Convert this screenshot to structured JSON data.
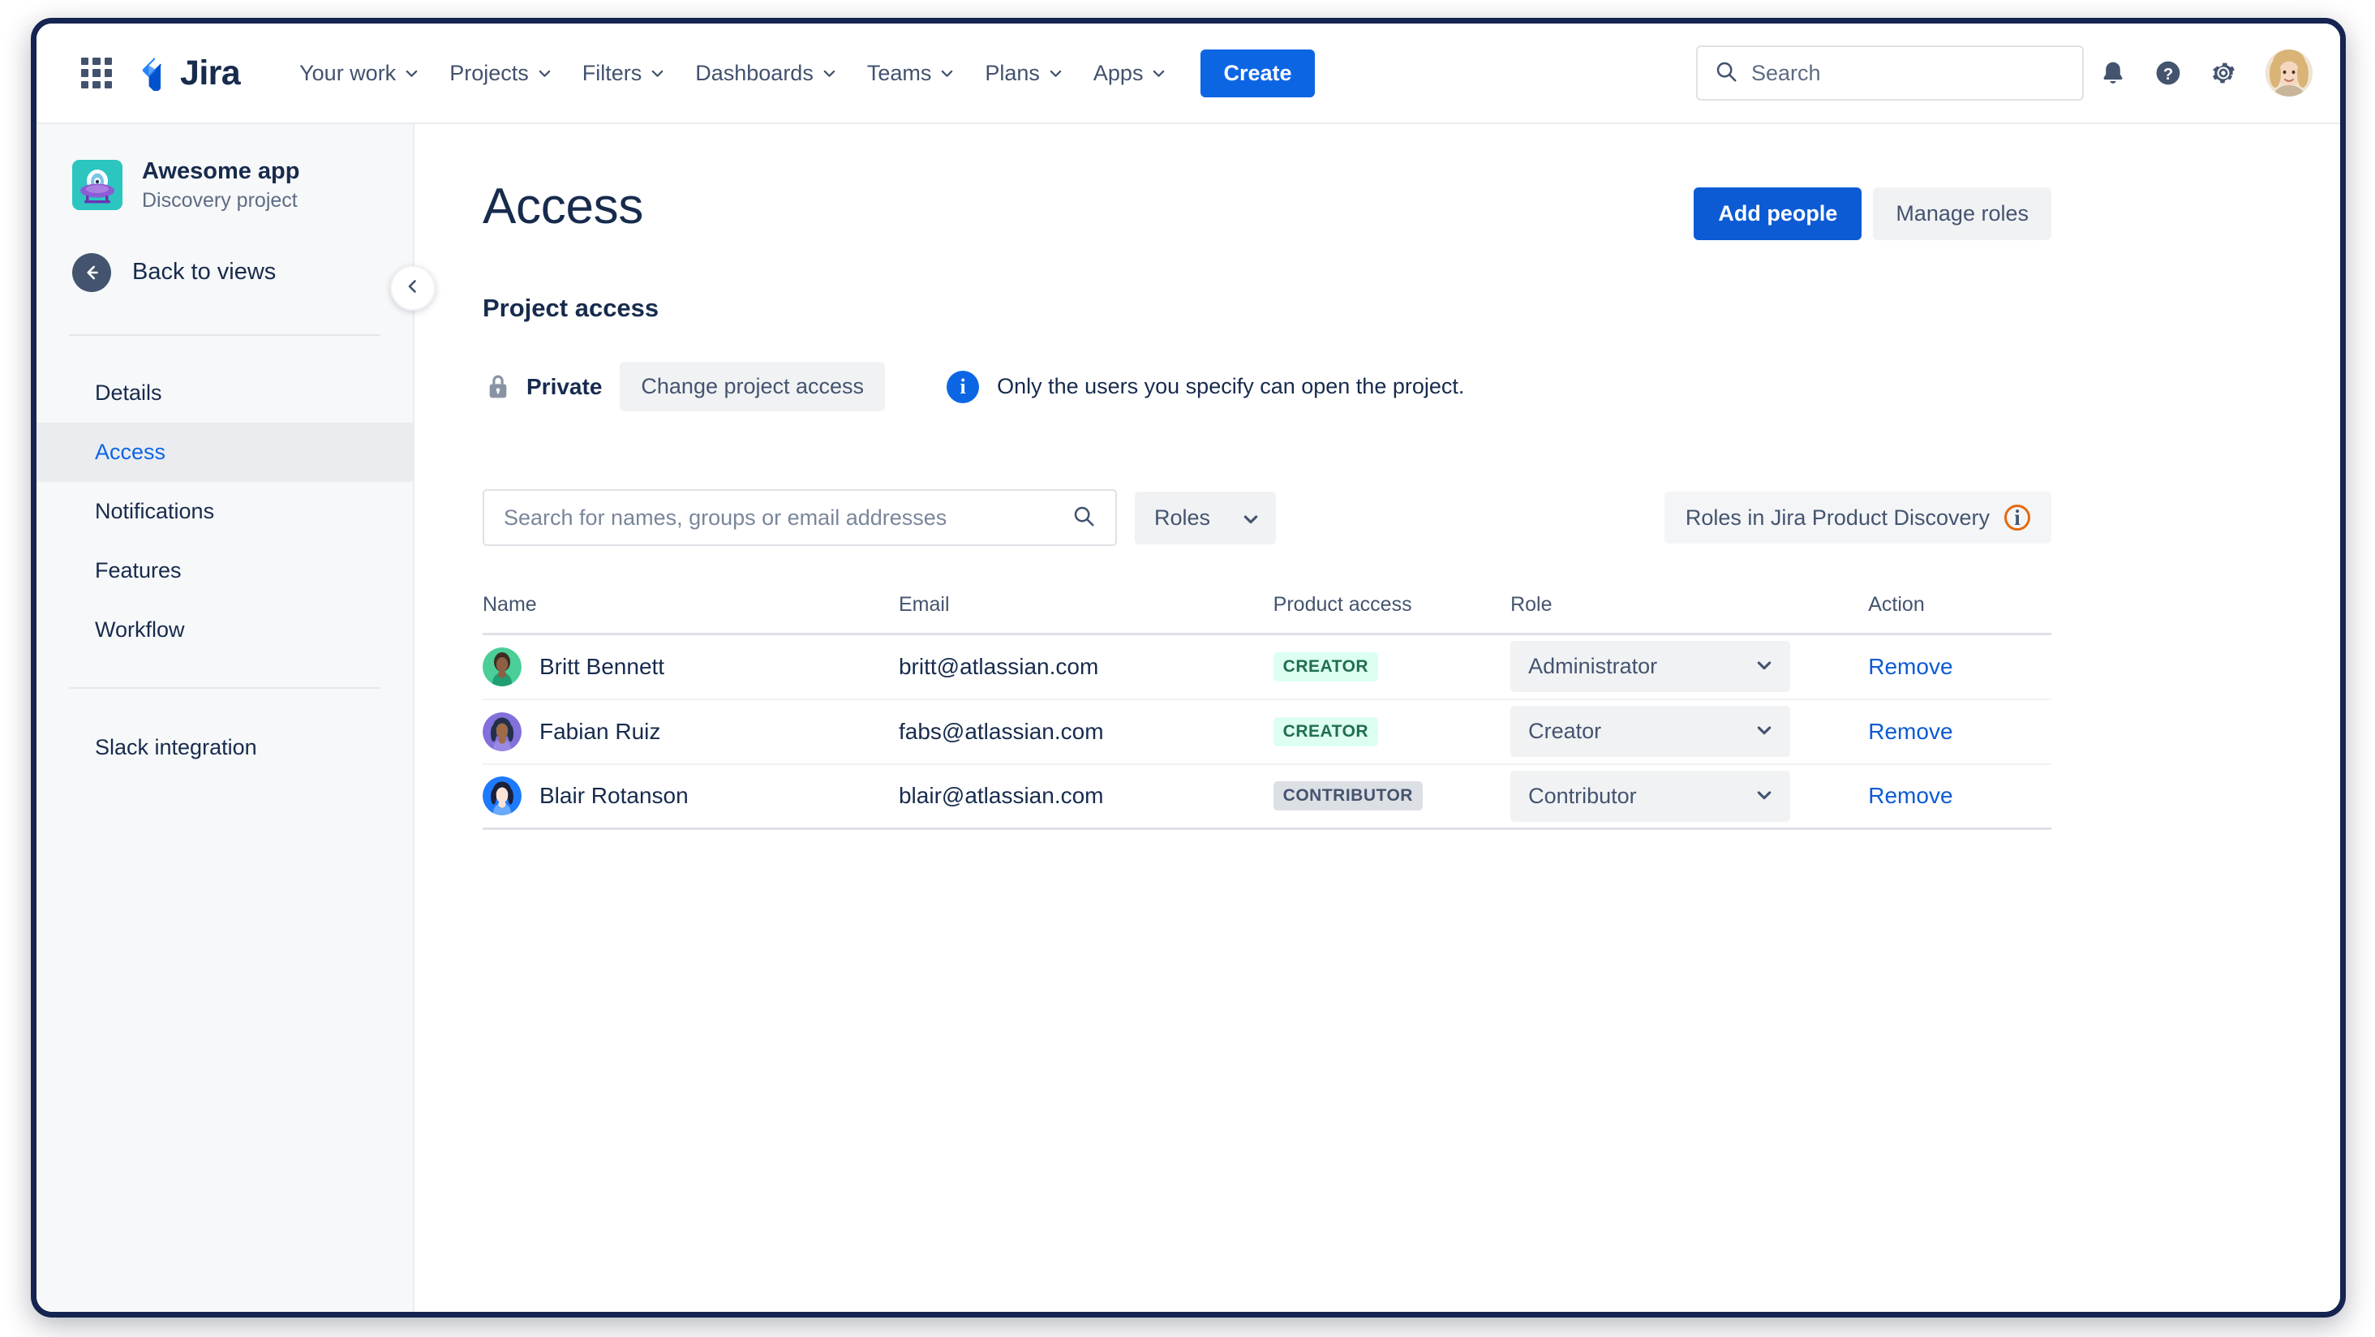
{
  "topnav": {
    "app_switcher": "app-switcher",
    "logo_text": "Jira",
    "items": [
      {
        "label": "Your work"
      },
      {
        "label": "Projects"
      },
      {
        "label": "Filters"
      },
      {
        "label": "Dashboards"
      },
      {
        "label": "Teams"
      },
      {
        "label": "Plans"
      },
      {
        "label": "Apps"
      }
    ],
    "create_label": "Create",
    "search_placeholder": "Search",
    "search_value": "",
    "icons": [
      "notifications-icon",
      "help-icon",
      "settings-icon",
      "profile-avatar"
    ]
  },
  "sidebar": {
    "project_name": "Awesome app",
    "project_type": "Discovery project",
    "back_label": "Back to views",
    "collapse_label": "collapse-sidebar",
    "items": [
      {
        "label": "Details",
        "active": false
      },
      {
        "label": "Access",
        "active": true
      },
      {
        "label": "Notifications",
        "active": false
      },
      {
        "label": "Features",
        "active": false
      },
      {
        "label": "Workflow",
        "active": false
      }
    ],
    "secondary_items": [
      {
        "label": "Slack integration"
      }
    ]
  },
  "main": {
    "page_title": "Access",
    "add_people_label": "Add people",
    "manage_roles_label": "Manage roles",
    "section_title": "Project access",
    "private_label": "Private",
    "change_access_label": "Change project access",
    "access_note": "Only the users you specify can open the project.",
    "info_glyph": "i",
    "search_placeholder": "Search for names, groups or email addresses",
    "search_value": "",
    "roles_filter_label": "Roles",
    "roles_link_label": "Roles in Jira Product Discovery",
    "table": {
      "headers": [
        "Name",
        "Email",
        "Product access",
        "Role",
        "Action"
      ],
      "rows": [
        {
          "name": "Britt Bennett",
          "email": "britt@atlassian.com",
          "product_access": "CREATOR",
          "product_access_type": "creator",
          "role": "Administrator",
          "action": "Remove",
          "avatar_color": "#4bce97"
        },
        {
          "name": "Fabian Ruiz",
          "email": "fabs@atlassian.com",
          "product_access": "CREATOR",
          "product_access_type": "creator",
          "role": "Creator",
          "action": "Remove",
          "avatar_color": "#8270db"
        },
        {
          "name": "Blair Rotanson",
          "email": "blair@atlassian.com",
          "product_access": "CONTRIBUTOR",
          "product_access_type": "contributor",
          "role": "Contributor",
          "action": "Remove",
          "avatar_color": "#1d7afc"
        }
      ]
    }
  },
  "colors": {
    "brand_blue": "#0c66e4",
    "primary_button": "#0c5bd4",
    "link_blue": "#0c5bd4",
    "creator_badge_bg": "#dcfff1",
    "creator_badge_text": "#216e4e",
    "contributor_badge_bg": "#dcdfe4",
    "contributor_badge_text": "#44546f",
    "info_orange": "#e56910",
    "sidebar_bg": "#f7f8f9",
    "project_icon_bg": "#2cc5c0"
  }
}
